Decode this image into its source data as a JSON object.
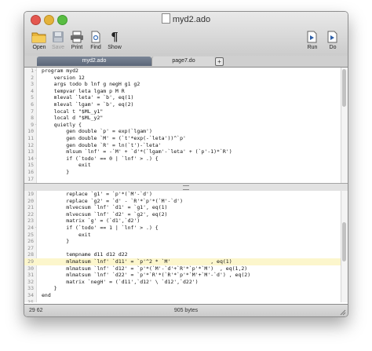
{
  "window": {
    "title": "myd2.ado"
  },
  "toolbar": {
    "open": "Open",
    "save": "Save",
    "print": "Print",
    "find": "Find",
    "show": "Show",
    "run": "Run",
    "do": "Do"
  },
  "tabs": [
    {
      "label": "myd2.ado"
    },
    {
      "label": "page7.do"
    }
  ],
  "top_pane": {
    "lines": [
      {
        "n": "1",
        "fold": "-",
        "text": "program myd2"
      },
      {
        "n": "2",
        "fold": "",
        "text": "    version 12"
      },
      {
        "n": "3",
        "fold": "",
        "text": "    args todo b lnf g negH g1 g2"
      },
      {
        "n": "4",
        "fold": "",
        "text": "    tempvar leta lgam p M R"
      },
      {
        "n": "5",
        "fold": "",
        "text": "    mleval `leta' = `b', eq(1)"
      },
      {
        "n": "6",
        "fold": "",
        "text": "    mleval `lgam' = `b', eq(2)"
      },
      {
        "n": "7",
        "fold": "",
        "text": "    local t \"$ML_y1\""
      },
      {
        "n": "8",
        "fold": "",
        "text": "    local d \"$ML_y2\""
      },
      {
        "n": "9",
        "fold": "-",
        "text": "    quietly {"
      },
      {
        "n": "10",
        "fold": "",
        "text": "        gen double `p' = exp(`lgam')"
      },
      {
        "n": "11",
        "fold": "",
        "text": "        gen double `M' = (`t'*exp(-`leta'))^`p'"
      },
      {
        "n": "12",
        "fold": "",
        "text": "        gen double `R' = ln(`t')-`leta'"
      },
      {
        "n": "13",
        "fold": "",
        "text": "        mlsum `lnf' = -`M' + `d'*(`lgam'-`leta' + (`p'-1)*`R')"
      },
      {
        "n": "14",
        "fold": "-",
        "text": "        if (`todo' == 0 | `lnf' > .) {"
      },
      {
        "n": "15",
        "fold": "",
        "text": "            exit"
      },
      {
        "n": "16",
        "fold": "",
        "text": "        }"
      },
      {
        "n": "17",
        "fold": "",
        "text": ""
      },
      {
        "n": "18",
        "fold": "",
        "text": "        tempname d1 d2"
      }
    ]
  },
  "bottom_pane": {
    "lines": [
      {
        "n": "19",
        "fold": "",
        "text": "        replace `g1' = `p'*(`M'-`d')"
      },
      {
        "n": "20",
        "fold": "",
        "text": "        replace `g2' = `d' - `R'*`p'*(`M'-`d')"
      },
      {
        "n": "21",
        "fold": "",
        "text": "        mlvecsum `lnf' `d1' = `g1', eq(1)"
      },
      {
        "n": "22",
        "fold": "",
        "text": "        mlvecsum `lnf' `d2' = `g2', eq(2)"
      },
      {
        "n": "23",
        "fold": "",
        "text": "        matrix `g' = (`d1',`d2')"
      },
      {
        "n": "24",
        "fold": "-",
        "text": "        if (`todo' == 1 | `lnf' > .) {"
      },
      {
        "n": "25",
        "fold": "",
        "text": "            exit"
      },
      {
        "n": "26",
        "fold": "",
        "text": "        }"
      },
      {
        "n": "27",
        "fold": "",
        "text": ""
      },
      {
        "n": "28",
        "fold": "",
        "text": "        tempname d11 d12 d22"
      },
      {
        "n": "29",
        "fold": "",
        "text": "        mlmatsum `lnf' `d11' = `p'^2 * `M'             , eq(1)",
        "highlight": true
      },
      {
        "n": "30",
        "fold": "",
        "text": "        mlmatsum `lnf' `d12' = `p'*(`M'-`d'+`R'*`p'*`M')  , eq(1,2)"
      },
      {
        "n": "31",
        "fold": "",
        "text": "        mlmatsum `lnf' `d22' = `p'*`R'*(`R'*`p'*`M'+`M'-`d') , eq(2)"
      },
      {
        "n": "32",
        "fold": "",
        "text": "        matrix `negH' = (`d11',`d12' \\ `d12',`d22')"
      },
      {
        "n": "33",
        "fold": "",
        "text": "    }"
      },
      {
        "n": "34",
        "fold": "",
        "text": "end"
      },
      {
        "n": "35",
        "fold": "",
        "text": ""
      },
      {
        "n": "36",
        "fold": "",
        "text": ""
      },
      {
        "n": "37",
        "fold": "",
        "text": ""
      },
      {
        "n": "38",
        "fold": "",
        "text": ""
      }
    ]
  },
  "status": {
    "position": "29  62",
    "bytes": "905 bytes"
  }
}
